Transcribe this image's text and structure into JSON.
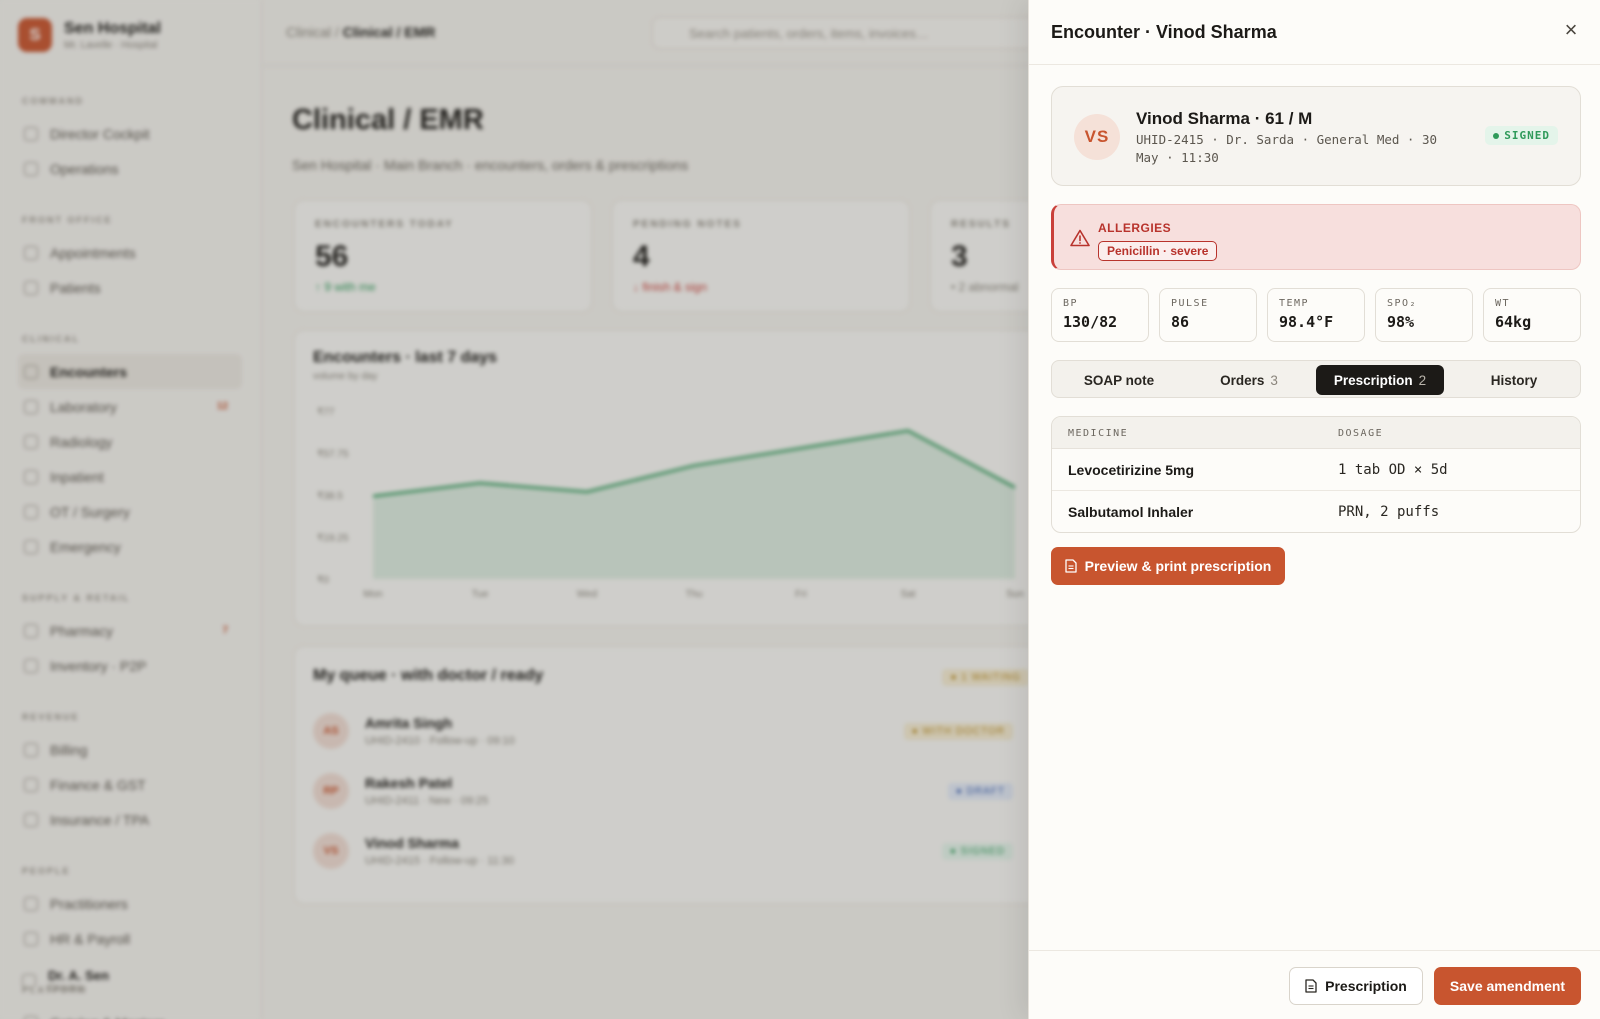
{
  "background": {
    "brand": {
      "name": "Sen Hospital",
      "sub": "Mr. Lavelle · Hospital"
    },
    "nav": [
      {
        "heading": "COMMAND",
        "items": [
          {
            "label": "Director Cockpit"
          },
          {
            "label": "Operations"
          }
        ]
      },
      {
        "heading": "FRONT OFFICE",
        "items": [
          {
            "label": "Appointments"
          },
          {
            "label": "Patients"
          }
        ]
      },
      {
        "heading": "CLINICAL",
        "items": [
          {
            "label": "Encounters",
            "active": true
          },
          {
            "label": "Laboratory",
            "badge": "12"
          },
          {
            "label": "Radiology"
          },
          {
            "label": "Inpatient"
          },
          {
            "label": "OT / Surgery"
          },
          {
            "label": "Emergency"
          }
        ]
      },
      {
        "heading": "SUPPLY & RETAIL",
        "items": [
          {
            "label": "Pharmacy",
            "badge": "7"
          },
          {
            "label": "Inventory · P2P"
          }
        ]
      },
      {
        "heading": "REVENUE",
        "items": [
          {
            "label": "Billing"
          },
          {
            "label": "Finance & GST"
          },
          {
            "label": "Insurance / TPA"
          }
        ]
      },
      {
        "heading": "PEOPLE",
        "items": [
          {
            "label": "Practitioners"
          },
          {
            "label": "HR & Payroll"
          }
        ]
      },
      {
        "heading": "PLATFORM",
        "items": [
          {
            "label": "Catalog & Masters"
          }
        ]
      }
    ],
    "user": {
      "name": "Dr. A. Sen",
      "role": "Director"
    },
    "breadcrumb": {
      "parent": "Clinical",
      "current": "Clinical / EMR"
    },
    "search_placeholder": "Search patients, orders, items, invoices…",
    "page_title": "Clinical / EMR",
    "page_subtitle": "Sen Hospital · Main Branch · encounters, orders & prescriptions",
    "stats": [
      {
        "label": "ENCOUNTERS TODAY",
        "value": "56",
        "delta": "↑ 9 with me"
      },
      {
        "label": "PENDING NOTES",
        "value": "4",
        "delta": "↓ finish & sign"
      },
      {
        "label": "RESULTS",
        "value": "3",
        "delta": "• 2 abnormal"
      }
    ],
    "chart_card": {
      "title": "Encounters · last 7 days",
      "subtitle": "volume by day"
    },
    "chart_data": {
      "type": "area",
      "title": "Encounters · last 7 days",
      "categories": [
        "Mon",
        "Tue",
        "Wed",
        "Thu",
        "Fri",
        "Sat",
        "Sun"
      ],
      "values": [
        38,
        44,
        40,
        52,
        60,
        68,
        42
      ],
      "y_ticks": [
        "₹0",
        "₹19.25",
        "₹38.5",
        "₹57.75",
        "₹77"
      ],
      "ylim": [
        0,
        77
      ],
      "grid": false
    },
    "queue": {
      "title": "My queue · with doctor / ready",
      "badge": "● 1 WAITING",
      "rows": [
        {
          "initials": "AS",
          "name": "Amrita Singh",
          "meta": "UHID-2410 · Follow-up · 09:10",
          "status": "● WITH DOCTOR"
        },
        {
          "initials": "RP",
          "name": "Rakesh Patel",
          "meta": "UHID-2411 · New · 09:25",
          "status": "● DRAFT"
        },
        {
          "initials": "VS",
          "name": "Vinod Sharma",
          "meta": "UHID-2415 · Follow-up · 11:30",
          "status": "● SIGNED"
        }
      ]
    }
  },
  "drawer": {
    "title": "Encounter · Vinod Sharma",
    "close_icon": "×",
    "patient": {
      "initials": "VS",
      "name": "Vinod Sharma · 61 / M",
      "meta": "UHID-2415 · Dr. Sarda · General Med · 30 May · 11:30",
      "status": "SIGNED"
    },
    "allergies": {
      "label": "ALLERGIES",
      "tag": "Penicillin · severe"
    },
    "vitals": [
      {
        "label": "BP",
        "value": "130/82"
      },
      {
        "label": "PULSE",
        "value": "86"
      },
      {
        "label": "TEMP",
        "value": "98.4°F"
      },
      {
        "label": "SPO₂",
        "value": "98%"
      },
      {
        "label": "WT",
        "value": "64kg"
      }
    ],
    "tabs": [
      {
        "label": "SOAP note",
        "count": ""
      },
      {
        "label": "Orders",
        "count": "3"
      },
      {
        "label": "Prescription",
        "count": "2",
        "active": true
      },
      {
        "label": "History",
        "count": ""
      }
    ],
    "prescription": {
      "columns": [
        "MEDICINE",
        "DOSAGE"
      ],
      "rows": [
        {
          "medicine": "Levocetirizine 5mg",
          "dosage": "1 tab OD × 5d"
        },
        {
          "medicine": "Salbutamol Inhaler",
          "dosage": "PRN, 2 puffs"
        }
      ]
    },
    "preview_button": "Preview & print prescription",
    "footer": {
      "prescription_button": "Prescription",
      "save_button": "Save amendment"
    }
  },
  "colors": {
    "accent": "#c8552f",
    "signed": "#2f9a5a",
    "allergy": "#b8332c",
    "dark": "#1c1a17"
  }
}
